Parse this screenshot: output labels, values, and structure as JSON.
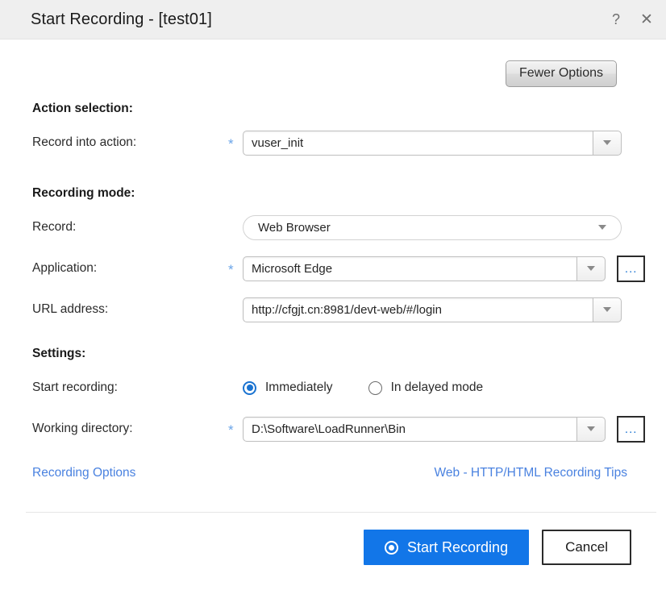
{
  "window": {
    "title": "Start Recording - [test01]",
    "help_icon": "question-mark-icon",
    "close_icon": "close-icon"
  },
  "toolbar": {
    "fewer_options_label": "Fewer Options"
  },
  "sections": {
    "action_selection": {
      "heading": "Action selection:",
      "record_into_action": {
        "label": "Record into action:",
        "required_marker": "*",
        "value": "vuser_init"
      }
    },
    "recording_mode": {
      "heading": "Recording mode:",
      "record": {
        "label": "Record:",
        "value": "Web Browser"
      },
      "application": {
        "label": "Application:",
        "required_marker": "*",
        "value": "Microsoft Edge",
        "browse_label": "..."
      },
      "url_address": {
        "label": "URL address:",
        "value": "http://cfgjt.cn:8981/devt-web/#/login"
      }
    },
    "settings": {
      "heading": "Settings:",
      "start_recording": {
        "label": "Start recording:",
        "options": [
          {
            "label": "Immediately",
            "selected": true
          },
          {
            "label": "In delayed mode",
            "selected": false
          }
        ]
      },
      "working_directory": {
        "label": "Working directory:",
        "required_marker": "*",
        "value": "D:\\Software\\LoadRunner\\Bin",
        "browse_label": "..."
      }
    }
  },
  "links": {
    "recording_options": "Recording Options",
    "recording_tips": "Web - HTTP/HTML Recording Tips"
  },
  "footer": {
    "primary_label": "Start Recording",
    "secondary_label": "Cancel"
  },
  "colors": {
    "accent_blue": "#1276e8",
    "link_blue": "#4a82e0",
    "required_star": "#6aa4e8",
    "titlebar_bg": "#efefef"
  }
}
